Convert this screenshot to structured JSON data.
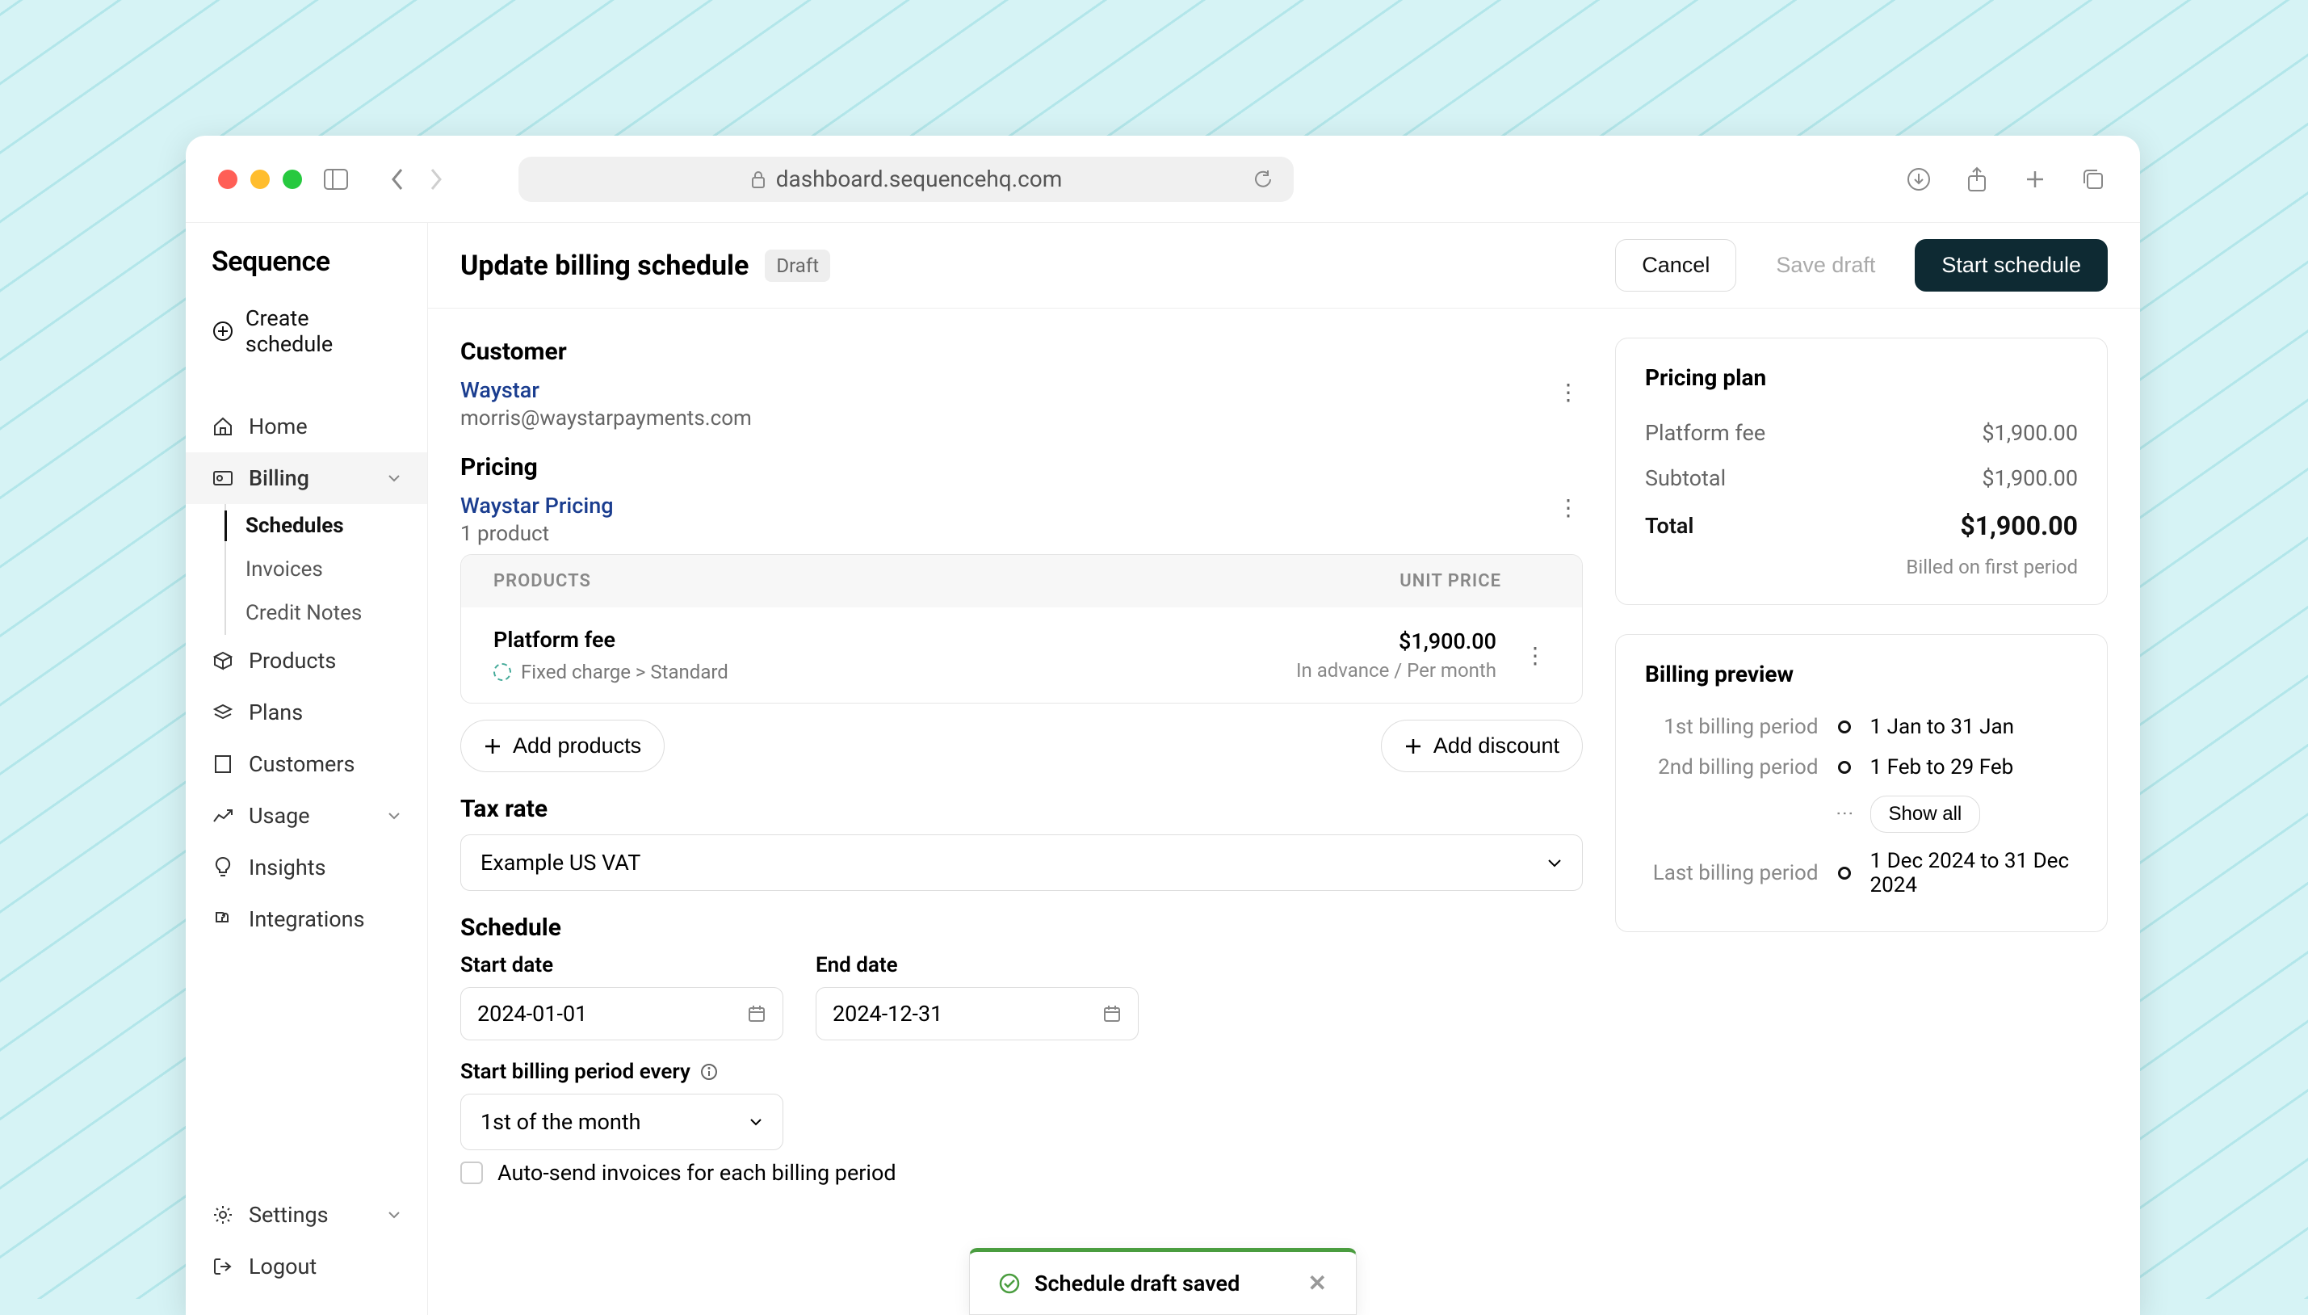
{
  "browser": {
    "url": "dashboard.sequencehq.com"
  },
  "brand": "Sequence",
  "sidebar": {
    "create": "Create schedule",
    "home": "Home",
    "billing": "Billing",
    "billing_children": {
      "schedules": "Schedules",
      "invoices": "Invoices",
      "credit_notes": "Credit Notes"
    },
    "products": "Products",
    "plans": "Plans",
    "customers": "Customers",
    "usage": "Usage",
    "insights": "Insights",
    "integrations": "Integrations",
    "settings": "Settings",
    "logout": "Logout"
  },
  "header": {
    "title": "Update billing schedule",
    "badge": "Draft",
    "cancel": "Cancel",
    "save_draft": "Save draft",
    "start": "Start schedule"
  },
  "customer": {
    "heading": "Customer",
    "name": "Waystar",
    "email": "morris@waystarpayments.com"
  },
  "pricing": {
    "heading": "Pricing",
    "name": "Waystar Pricing",
    "count": "1 product",
    "table": {
      "col_products": "PRODUCTS",
      "col_price": "UNIT PRICE",
      "row": {
        "name": "Platform fee",
        "meta": "Fixed charge > Standard",
        "price": "$1,900.00",
        "schedule": "In advance / Per month"
      }
    },
    "add_products": "Add products",
    "add_discount": "Add discount"
  },
  "tax": {
    "heading": "Tax rate",
    "value": "Example US VAT"
  },
  "schedule": {
    "heading": "Schedule",
    "start_label": "Start date",
    "start_value": "2024-01-01",
    "end_label": "End date",
    "end_value": "2024-12-31",
    "period_label": "Start billing period every",
    "period_value": "1st of the month",
    "auto_send": "Auto-send invoices for each billing period"
  },
  "plan": {
    "heading": "Pricing plan",
    "rows": {
      "platform_label": "Platform fee",
      "platform_value": "$1,900.00",
      "subtotal_label": "Subtotal",
      "subtotal_value": "$1,900.00",
      "total_label": "Total",
      "total_value": "$1,900.00"
    },
    "note": "Billed on first period"
  },
  "preview": {
    "heading": "Billing preview",
    "p1_label": "1st billing period",
    "p1_value": "1 Jan to 31 Jan",
    "p2_label": "2nd billing period",
    "p2_value": "1 Feb to 29 Feb",
    "show_all": "Show all",
    "last_label": "Last billing period",
    "last_value": "1 Dec 2024 to 31 Dec 2024"
  },
  "toast": {
    "message": "Schedule draft saved"
  }
}
